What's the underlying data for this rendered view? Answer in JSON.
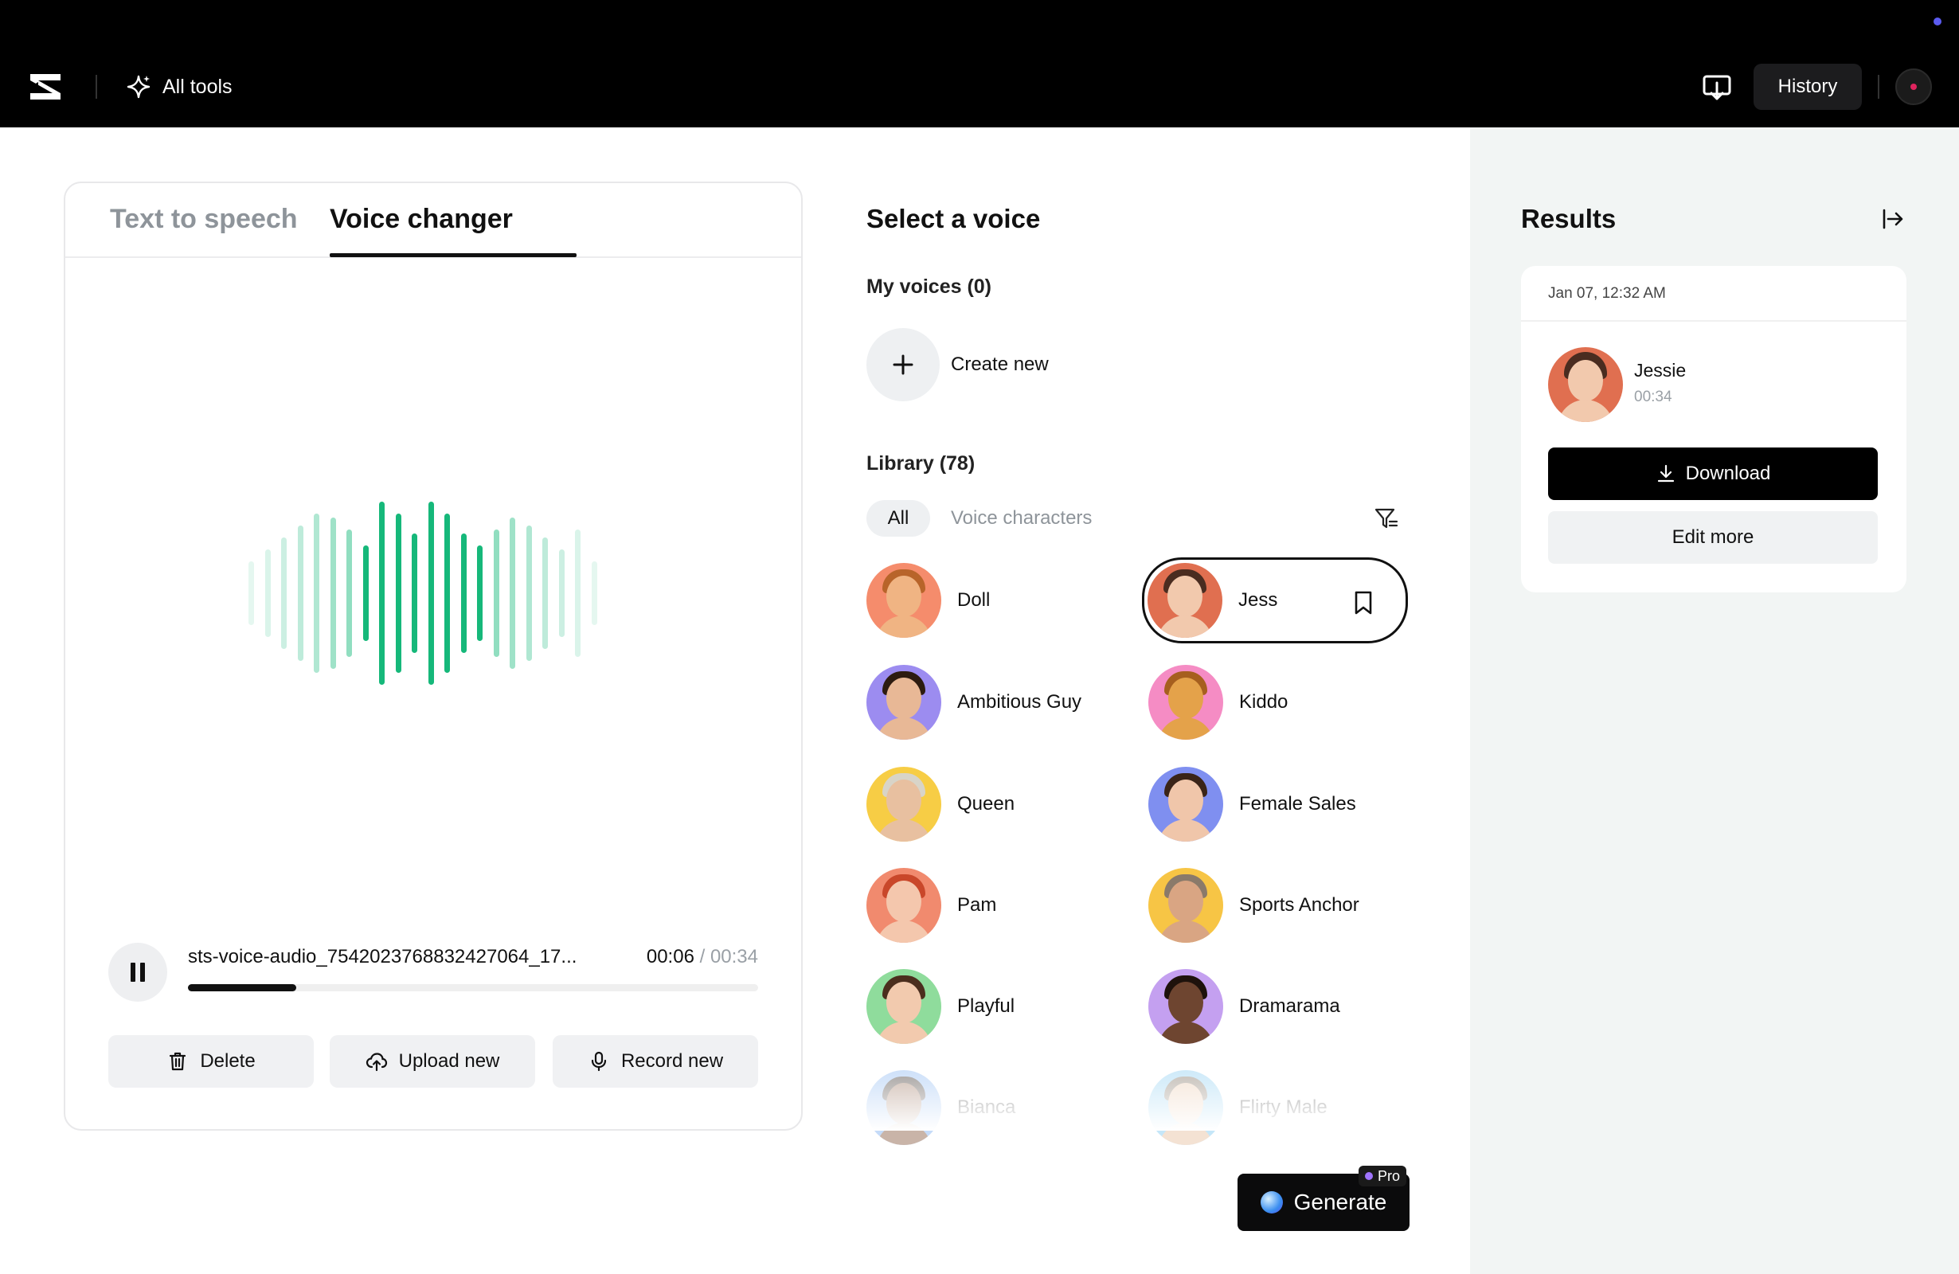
{
  "topbar": {
    "all_tools_label": "All tools",
    "history_label": "History",
    "icons": [
      "capcut-logo-icon",
      "sparkle-icon",
      "screen-download-icon",
      "avatar"
    ]
  },
  "tabs": [
    {
      "label": "Text to speech",
      "active": false
    },
    {
      "label": "Voice changer",
      "active": true
    }
  ],
  "player": {
    "file_name": "sts-voice-audio_7542023768832427064_17...",
    "current_time": "00:06",
    "separator": " / ",
    "total_time": "00:34",
    "progress": 0.19
  },
  "actions": {
    "delete_label": "Delete",
    "upload_label": "Upload new",
    "record_label": "Record new"
  },
  "voices_panel": {
    "title": "Select a voice",
    "my_voices_label": "My voices (0)",
    "create_new_label": "Create new",
    "library_label": "Library (78)",
    "filters": {
      "all": "All",
      "voice_characters": "Voice characters"
    },
    "voices": [
      {
        "name": "Doll",
        "skin": "#f0b483",
        "hair": "#b8642a",
        "bg": "#f58c6c"
      },
      {
        "name": "Jessie",
        "display": "Jess",
        "selected": true,
        "skin": "#f2c9ad",
        "hair": "#4a2c20",
        "bg": "#e06f50"
      },
      {
        "name": "Ambitious Guy",
        "skin": "#e8b896",
        "hair": "#2d1b10",
        "bg": "#9c8cf0"
      },
      {
        "name": "Kiddo",
        "skin": "#e4a24a",
        "hair": "#a65f1e",
        "bg": "#f58cc4"
      },
      {
        "name": "Queen",
        "skin": "#e8c0a0",
        "hair": "#d8d4c8",
        "bg": "#f7cd45"
      },
      {
        "name": "Female Sales",
        "skin": "#f0c6aa",
        "hair": "#3a2418",
        "bg": "#7f8ff0"
      },
      {
        "name": "Pam",
        "skin": "#f4c7ad",
        "hair": "#c9472a",
        "bg": "#f18a6e"
      },
      {
        "name": "Sports Anchor",
        "skin": "#d9a583",
        "hair": "#8a7a6a",
        "bg": "#f7c545"
      },
      {
        "name": "Playful",
        "skin": "#f2caae",
        "hair": "#4b2e1e",
        "bg": "#8fdc9c"
      },
      {
        "name": "Dramarama",
        "skin": "#6e4530",
        "hair": "#1e120c",
        "bg": "#c4a0f0"
      },
      {
        "name": "Bianca",
        "skin": "#8a5a40",
        "hair": "#1a100a",
        "bg": "#7fb0f0",
        "faded": true
      },
      {
        "name": "Flirty Male",
        "skin": "#e8c0a0",
        "hair": "#6b5a48",
        "bg": "#7fcaf0",
        "faded": true
      }
    ]
  },
  "generate": {
    "label": "Generate",
    "badge": "Pro"
  },
  "results": {
    "title": "Results",
    "date": "Jan 07, 12:32 AM",
    "name": "Jessie",
    "duration": "00:34",
    "download_label": "Download",
    "edit_label": "Edit more"
  },
  "colors": {
    "accent_green": "#16b87a",
    "top_bar": "#000000",
    "right_panel_bg": "#f2f5f4"
  }
}
